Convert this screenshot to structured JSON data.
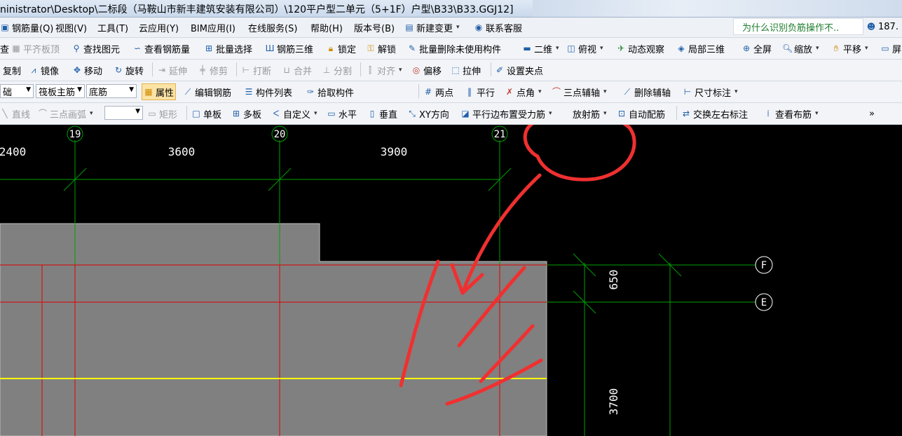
{
  "title": "ninistrator\\Desktop\\二标段（马鞍山市新丰建筑安装有限公司）\\120平户型二单元（5+1F）户型\\B33\\B33.GGJ12]",
  "menu": {
    "items": [
      "钢筋量(Q)",
      "视图(V)",
      "工具(T)",
      "云应用(Y)",
      "BIM应用(I)",
      "在线服务(S)",
      "帮助(H)",
      "版本号(B)",
      "新建变更",
      "联系客服"
    ],
    "notice": "为什么识别负筋操作不..",
    "account": "187."
  },
  "toolbar1": [
    "查",
    "平齐板顶",
    "查找图元",
    "查看钢筋量",
    "批量选择",
    "钢筋三维",
    "锁定",
    "解锁",
    "批量删除未使用构件",
    "二维",
    "俯视",
    "动态观察",
    "局部三维",
    "全屏",
    "缩放",
    "平移",
    "屏"
  ],
  "toolbar2": [
    "复制",
    "镜像",
    "移动",
    "旋转",
    "延伸",
    "修剪",
    "打断",
    "合并",
    "分割",
    "对齐",
    "偏移",
    "拉伸",
    "设置夹点"
  ],
  "toolbar3": {
    "combo1": "础",
    "combo2": "筏板主筋",
    "combo3": "底筋",
    "items": [
      "属性",
      "编辑钢筋",
      "构件列表",
      "拾取构件",
      "两点",
      "平行",
      "点角",
      "三点辅轴",
      "删除辅轴",
      "尺寸标注"
    ]
  },
  "toolbar4": {
    "items": [
      "直线",
      "三点画弧",
      "矩形",
      "单板",
      "多板",
      "自定义",
      "水平",
      "垂直",
      "XY方向",
      "平行边布置受力筋",
      "放射筋",
      "自动配筋",
      "交换左右标注",
      "查看布筋"
    ],
    "more": "»"
  },
  "cad": {
    "axes_vertical": [
      "19",
      "20",
      "21"
    ],
    "axes_horizontal": [
      "F",
      "E"
    ],
    "dimensions_top": [
      "2400",
      "3600",
      "3900"
    ],
    "dimensions_right": [
      "650",
      "3700"
    ]
  },
  "colors": {
    "canvas": "#000000",
    "slab": "#808080",
    "axis_line": "#00a000",
    "rebar_red": "#e00000",
    "rebar_yellow": "#ffff00",
    "annotation": "#f03030"
  }
}
